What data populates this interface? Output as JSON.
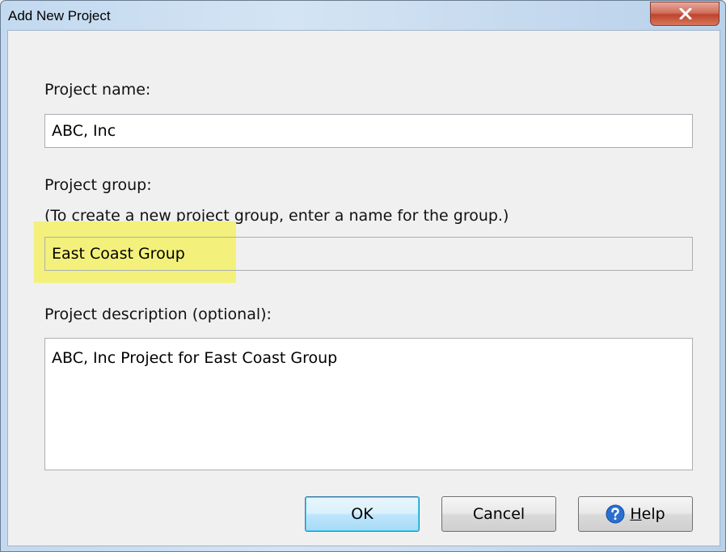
{
  "window": {
    "title": "Add New Project"
  },
  "form": {
    "project_name_label": "Project name:",
    "project_name_value": "ABC, Inc",
    "project_group_label": "Project group:",
    "project_group_hint": "(To create a new project group, enter a  name for the group.)",
    "project_group_value": "East Coast Group",
    "description_label": "Project description (optional):",
    "description_value": "ABC, Inc Project for East Coast Group"
  },
  "buttons": {
    "ok_label": "OK",
    "cancel_label": "Cancel",
    "help_mnemonic": "H",
    "help_rest": "elp"
  },
  "colors": {
    "highlight": "#f3f17b",
    "close_button": "#c0432c",
    "help_icon": "#2a6fd0"
  }
}
